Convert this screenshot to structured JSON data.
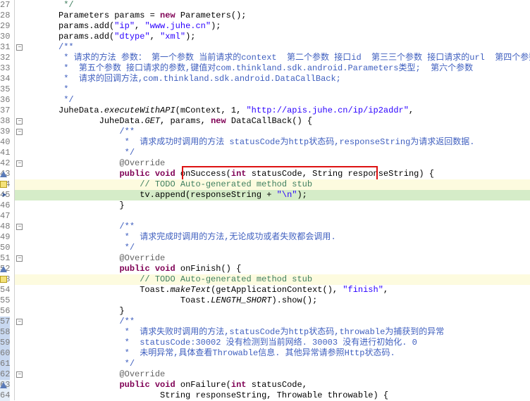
{
  "chart_data": null,
  "lines": [
    {
      "n": 27,
      "gutterClass": "",
      "fold": "",
      "bg": "",
      "segs": [
        {
          "c": "cmt",
          "t": "         */"
        }
      ]
    },
    {
      "n": 28,
      "gutterClass": "",
      "fold": "",
      "bg": "",
      "segs": [
        {
          "c": "plain",
          "t": "        Parameters params = "
        },
        {
          "c": "kw",
          "t": "new"
        },
        {
          "c": "plain",
          "t": " Parameters();"
        }
      ]
    },
    {
      "n": 29,
      "gutterClass": "",
      "fold": "",
      "bg": "",
      "segs": [
        {
          "c": "plain",
          "t": "        params.add("
        },
        {
          "c": "str",
          "t": "\"ip\""
        },
        {
          "c": "plain",
          "t": ", "
        },
        {
          "c": "str",
          "t": "\"www.juhe.cn\""
        },
        {
          "c": "plain",
          "t": ");"
        }
      ]
    },
    {
      "n": 30,
      "gutterClass": "",
      "fold": "",
      "bg": "",
      "segs": [
        {
          "c": "plain",
          "t": "        params.add("
        },
        {
          "c": "str",
          "t": "\"dtype\""
        },
        {
          "c": "plain",
          "t": ", "
        },
        {
          "c": "str",
          "t": "\"xml\""
        },
        {
          "c": "plain",
          "t": ");"
        }
      ]
    },
    {
      "n": 31,
      "gutterClass": "",
      "fold": "-",
      "bg": "",
      "segs": [
        {
          "c": "doc",
          "t": "        /**"
        }
      ]
    },
    {
      "n": 32,
      "gutterClass": "",
      "fold": "",
      "bg": "",
      "segs": [
        {
          "c": "doc",
          "t": "         * 请求的方法 参数： 第一个参数 当前请求的context  第二个参数 接口id  第三三个参数 接口请求的url  第四个参数 接口请求的方式"
        }
      ]
    },
    {
      "n": 33,
      "gutterClass": "",
      "fold": "",
      "bg": "",
      "segs": [
        {
          "c": "doc",
          "t": "         *  第五个参数 接口请求的参数,键值对com.thinkland.sdk.android.Parameters类型;  第六个参数"
        }
      ]
    },
    {
      "n": 34,
      "gutterClass": "",
      "fold": "",
      "bg": "",
      "segs": [
        {
          "c": "doc",
          "t": "         *  请求的回调方法,com.thinkland.sdk.android.DataCallBack;"
        }
      ]
    },
    {
      "n": 35,
      "gutterClass": "",
      "fold": "",
      "bg": "",
      "segs": [
        {
          "c": "doc",
          "t": "         *"
        }
      ]
    },
    {
      "n": 36,
      "gutterClass": "",
      "fold": "",
      "bg": "",
      "segs": [
        {
          "c": "doc",
          "t": "         */"
        }
      ]
    },
    {
      "n": 37,
      "gutterClass": "",
      "fold": "",
      "bg": "",
      "segs": [
        {
          "c": "plain",
          "t": "        JuheData."
        },
        {
          "c": "plain italic",
          "t": "executeWithAPI"
        },
        {
          "c": "plain",
          "t": "(mContext, 1, "
        },
        {
          "c": "str",
          "t": "\"http://apis.juhe.cn/ip/ip2addr\""
        },
        {
          "c": "plain",
          "t": ","
        }
      ]
    },
    {
      "n": 38,
      "gutterClass": "",
      "fold": "-",
      "bg": "",
      "segs": [
        {
          "c": "plain",
          "t": "                JuheData."
        },
        {
          "c": "plain italic",
          "t": "GET"
        },
        {
          "c": "plain",
          "t": ", params, "
        },
        {
          "c": "kw",
          "t": "new"
        },
        {
          "c": "plain",
          "t": " DataCallBack() {"
        }
      ]
    },
    {
      "n": 39,
      "gutterClass": "",
      "fold": "-",
      "bg": "",
      "segs": [
        {
          "c": "doc",
          "t": "                    /**"
        }
      ]
    },
    {
      "n": 40,
      "gutterClass": "",
      "fold": "",
      "bg": "",
      "segs": [
        {
          "c": "doc",
          "t": "                     *  请求成功时调用的方法 statusCode为http状态码,responseString为请求返回数据."
        }
      ]
    },
    {
      "n": 41,
      "gutterClass": "",
      "fold": "",
      "bg": "",
      "segs": [
        {
          "c": "doc",
          "t": "                     */"
        }
      ]
    },
    {
      "n": 42,
      "gutterClass": "",
      "fold": "-",
      "bg": "",
      "segs": [
        {
          "c": "annot",
          "t": "                    @Override"
        }
      ]
    },
    {
      "n": 43,
      "gutterClass": "tri",
      "fold": "",
      "bg": "",
      "segs": [
        {
          "c": "plain",
          "t": "                    "
        },
        {
          "c": "kw",
          "t": "public"
        },
        {
          "c": "plain",
          "t": " "
        },
        {
          "c": "kw",
          "t": "void"
        },
        {
          "c": "plain",
          "t": " onSuccess("
        },
        {
          "c": "kw",
          "t": "int"
        },
        {
          "c": "plain",
          "t": " statusCode, String responseString) {"
        }
      ],
      "redbox": true
    },
    {
      "n": 44,
      "gutterClass": "warn",
      "fold": "",
      "bg": "hl-yellow",
      "segs": [
        {
          "c": "plain",
          "t": "                        "
        },
        {
          "c": "cmt",
          "t": "// TODO Auto-generated method stub"
        }
      ]
    },
    {
      "n": 45,
      "gutterClass": "arrow",
      "fold": "",
      "bg": "hl-green",
      "segs": [
        {
          "c": "plain",
          "t": "                        tv.append(responseString + "
        },
        {
          "c": "str",
          "t": "\"\\n\""
        },
        {
          "c": "plain",
          "t": ");"
        }
      ]
    },
    {
      "n": 46,
      "gutterClass": "",
      "fold": "",
      "bg": "",
      "segs": [
        {
          "c": "plain",
          "t": "                    }"
        }
      ]
    },
    {
      "n": 47,
      "gutterClass": "",
      "fold": "",
      "bg": "",
      "segs": [
        {
          "c": "plain",
          "t": ""
        }
      ]
    },
    {
      "n": 48,
      "gutterClass": "",
      "fold": "-",
      "bg": "",
      "segs": [
        {
          "c": "doc",
          "t": "                    /**"
        }
      ]
    },
    {
      "n": 49,
      "gutterClass": "",
      "fold": "",
      "bg": "",
      "segs": [
        {
          "c": "doc",
          "t": "                     *  请求完成时调用的方法,无论成功或者失败都会调用."
        }
      ]
    },
    {
      "n": 50,
      "gutterClass": "",
      "fold": "",
      "bg": "",
      "segs": [
        {
          "c": "doc",
          "t": "                     */"
        }
      ]
    },
    {
      "n": 51,
      "gutterClass": "",
      "fold": "-",
      "bg": "",
      "segs": [
        {
          "c": "annot",
          "t": "                    @Override"
        }
      ]
    },
    {
      "n": 52,
      "gutterClass": "tri",
      "fold": "",
      "bg": "",
      "segs": [
        {
          "c": "plain",
          "t": "                    "
        },
        {
          "c": "kw",
          "t": "public"
        },
        {
          "c": "plain",
          "t": " "
        },
        {
          "c": "kw",
          "t": "void"
        },
        {
          "c": "plain",
          "t": " onFinish() {"
        }
      ]
    },
    {
      "n": 53,
      "gutterClass": "warn",
      "fold": "",
      "bg": "hl-yellow",
      "segs": [
        {
          "c": "plain",
          "t": "                        "
        },
        {
          "c": "cmt",
          "t": "// TODO Auto-generated method stub"
        }
      ]
    },
    {
      "n": 54,
      "gutterClass": "",
      "fold": "",
      "bg": "",
      "segs": [
        {
          "c": "plain",
          "t": "                        Toast."
        },
        {
          "c": "plain italic",
          "t": "makeText"
        },
        {
          "c": "plain",
          "t": "(getApplicationContext(), "
        },
        {
          "c": "str",
          "t": "\"finish\""
        },
        {
          "c": "plain",
          "t": ","
        }
      ]
    },
    {
      "n": 55,
      "gutterClass": "",
      "fold": "",
      "bg": "",
      "segs": [
        {
          "c": "plain",
          "t": "                                Toast."
        },
        {
          "c": "plain italic",
          "t": "LENGTH_SHORT"
        },
        {
          "c": "plain",
          "t": ").show();"
        }
      ]
    },
    {
      "n": 56,
      "gutterClass": "",
      "fold": "",
      "bg": "",
      "segs": [
        {
          "c": "plain",
          "t": "                    }"
        }
      ]
    },
    {
      "n": 57,
      "gutterClass": "hl-blue-gutter",
      "fold": "-",
      "bg": "",
      "segs": [
        {
          "c": "doc",
          "t": "                    /**"
        }
      ]
    },
    {
      "n": 58,
      "gutterClass": "hl-blue-gutter",
      "fold": "",
      "bg": "",
      "segs": [
        {
          "c": "doc",
          "t": "                     *  请求失败时调用的方法,statusCode为http状态码,throwable为捕获到的异常"
        }
      ]
    },
    {
      "n": 59,
      "gutterClass": "hl-blue-gutter",
      "fold": "",
      "bg": "",
      "segs": [
        {
          "c": "doc",
          "t": "                     *  statusCode:30002 没有检测到当前网络. 30003 没有进行初始化. 0"
        }
      ]
    },
    {
      "n": 60,
      "gutterClass": "hl-blue-gutter",
      "fold": "",
      "bg": "",
      "segs": [
        {
          "c": "doc",
          "t": "                     *  未明异常,具体查看Throwable信息. 其他异常请参照Http状态码."
        }
      ]
    },
    {
      "n": 61,
      "gutterClass": "hl-blue-gutter",
      "fold": "",
      "bg": "",
      "segs": [
        {
          "c": "doc",
          "t": "                     */"
        }
      ]
    },
    {
      "n": 62,
      "gutterClass": "hl-blue-gutter",
      "fold": "-",
      "bg": "",
      "segs": [
        {
          "c": "annot",
          "t": "                    @Override"
        }
      ]
    },
    {
      "n": 63,
      "gutterClass": "hl-ltblue-gutter tri",
      "fold": "",
      "bg": "",
      "segs": [
        {
          "c": "plain",
          "t": "                    "
        },
        {
          "c": "kw",
          "t": "public"
        },
        {
          "c": "plain",
          "t": " "
        },
        {
          "c": "kw",
          "t": "void"
        },
        {
          "c": "plain",
          "t": " onFailure("
        },
        {
          "c": "kw",
          "t": "int"
        },
        {
          "c": "plain",
          "t": " statusCode,"
        }
      ],
      "cursor": true
    },
    {
      "n": 64,
      "gutterClass": "hl-ltblue-gutter",
      "fold": "",
      "bg": "",
      "segs": [
        {
          "c": "plain",
          "t": "                            String responseString, Throwable throwable) {"
        }
      ]
    }
  ]
}
